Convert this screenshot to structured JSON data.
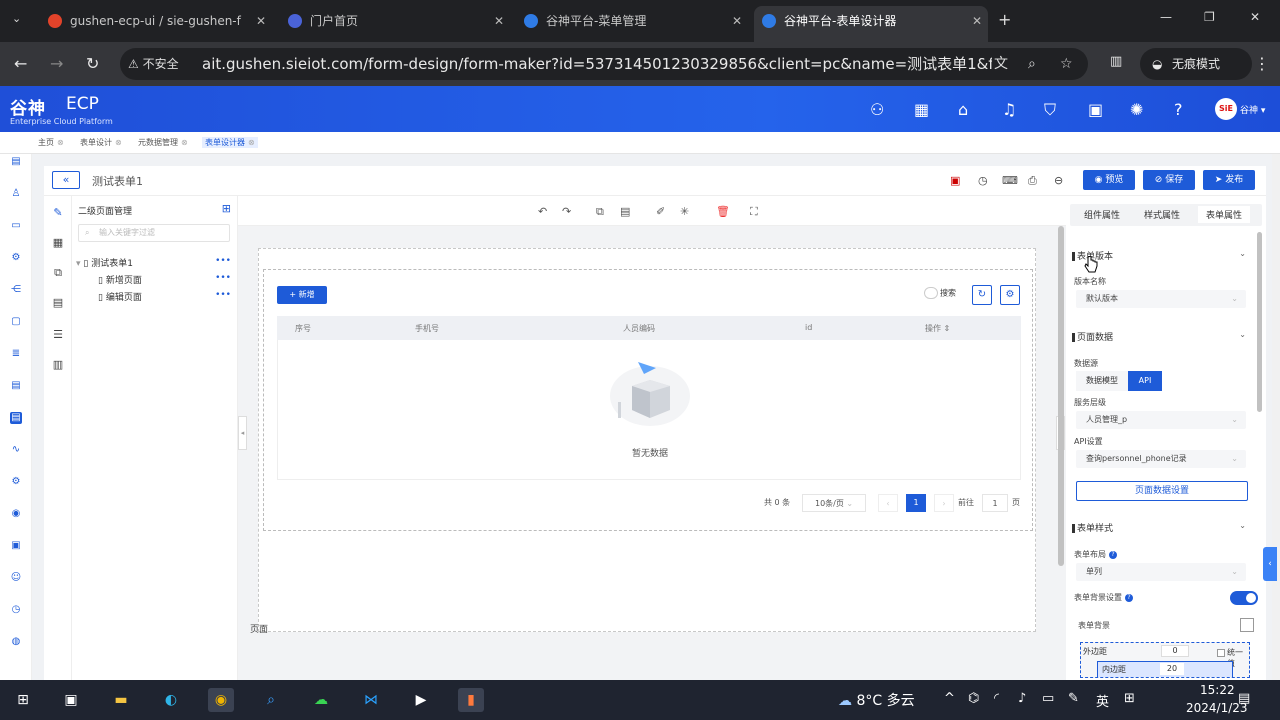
{
  "browser": {
    "tabs": [
      {
        "title": "gushen-ecp-ui / sie-gushen-f",
        "favColor": "#e2432a"
      },
      {
        "title": "门户首页",
        "favColor": "#4a63d8"
      },
      {
        "title": "谷神平台-菜单管理",
        "favColor": "#2f7be5"
      },
      {
        "title": "谷神平台-表单设计器",
        "favColor": "#2f7be5"
      }
    ],
    "insecure_label": "不安全",
    "url": "ait.gushen.sieiot.com/form-design/form-maker?id=537314501230329856&client=pc&name=测试表单1&formChan...",
    "incognito_label": "无痕模式"
  },
  "app": {
    "logo_cn": "谷神",
    "logo_en": "ECP",
    "logo_sub": "Enterprise Cloud Platform",
    "avatar_text": "SiE",
    "user_name": "谷神"
  },
  "crumbs": [
    "主页",
    "表单设计",
    "元数据管理",
    "表单设计器"
  ],
  "toolbar": {
    "form_title": "测试表单1",
    "preview": "预览",
    "save": "保存",
    "publish": "发布"
  },
  "tree": {
    "title": "二级页面管理",
    "search_placeholder": "输入关键字过滤",
    "root": "测试表单1",
    "children": [
      "新增页面",
      "编辑页面"
    ]
  },
  "canvas": {
    "add_button": "新增",
    "search_label": "搜索",
    "columns": [
      "序号",
      "手机号",
      "人员编码",
      "id",
      "操作"
    ],
    "empty_text": "暂无数据",
    "pager": {
      "total": "共 0 条",
      "page_size": "10条/页",
      "current_page": "1",
      "goto_label": "前往",
      "goto_value": "1",
      "page_unit": "页"
    },
    "page_label": "页面"
  },
  "props": {
    "tabs": [
      "组件属性",
      "样式属性",
      "表单属性"
    ],
    "version_section": "表单版本",
    "version_name_label": "版本名称",
    "version_name_value": "默认版本",
    "page_data_section": "页面数据",
    "datasource_label": "数据源",
    "datasource_options": [
      "数据模型",
      "API"
    ],
    "service_label": "服务层级",
    "service_value": "人员管理_p",
    "api_label": "API设置",
    "api_value": "查询personnel_phone记录",
    "page_data_button": "页面数据设置",
    "style_section": "表单样式",
    "layout_label": "表单布局",
    "layout_value": "单列",
    "bg_setting_label": "表单背景设置",
    "bg_label": "表单背景",
    "margin_label": "外边距",
    "margin_value": "0",
    "unify_label": "统一值",
    "padding_label": "内边距",
    "padding_value": "20"
  },
  "taskbar": {
    "weather": "8°C 多云",
    "ime": "英",
    "time": "15:22",
    "date": "2024/1/23"
  },
  "colors": {
    "accent": "#1e5bd8",
    "header": "#2563eb"
  }
}
